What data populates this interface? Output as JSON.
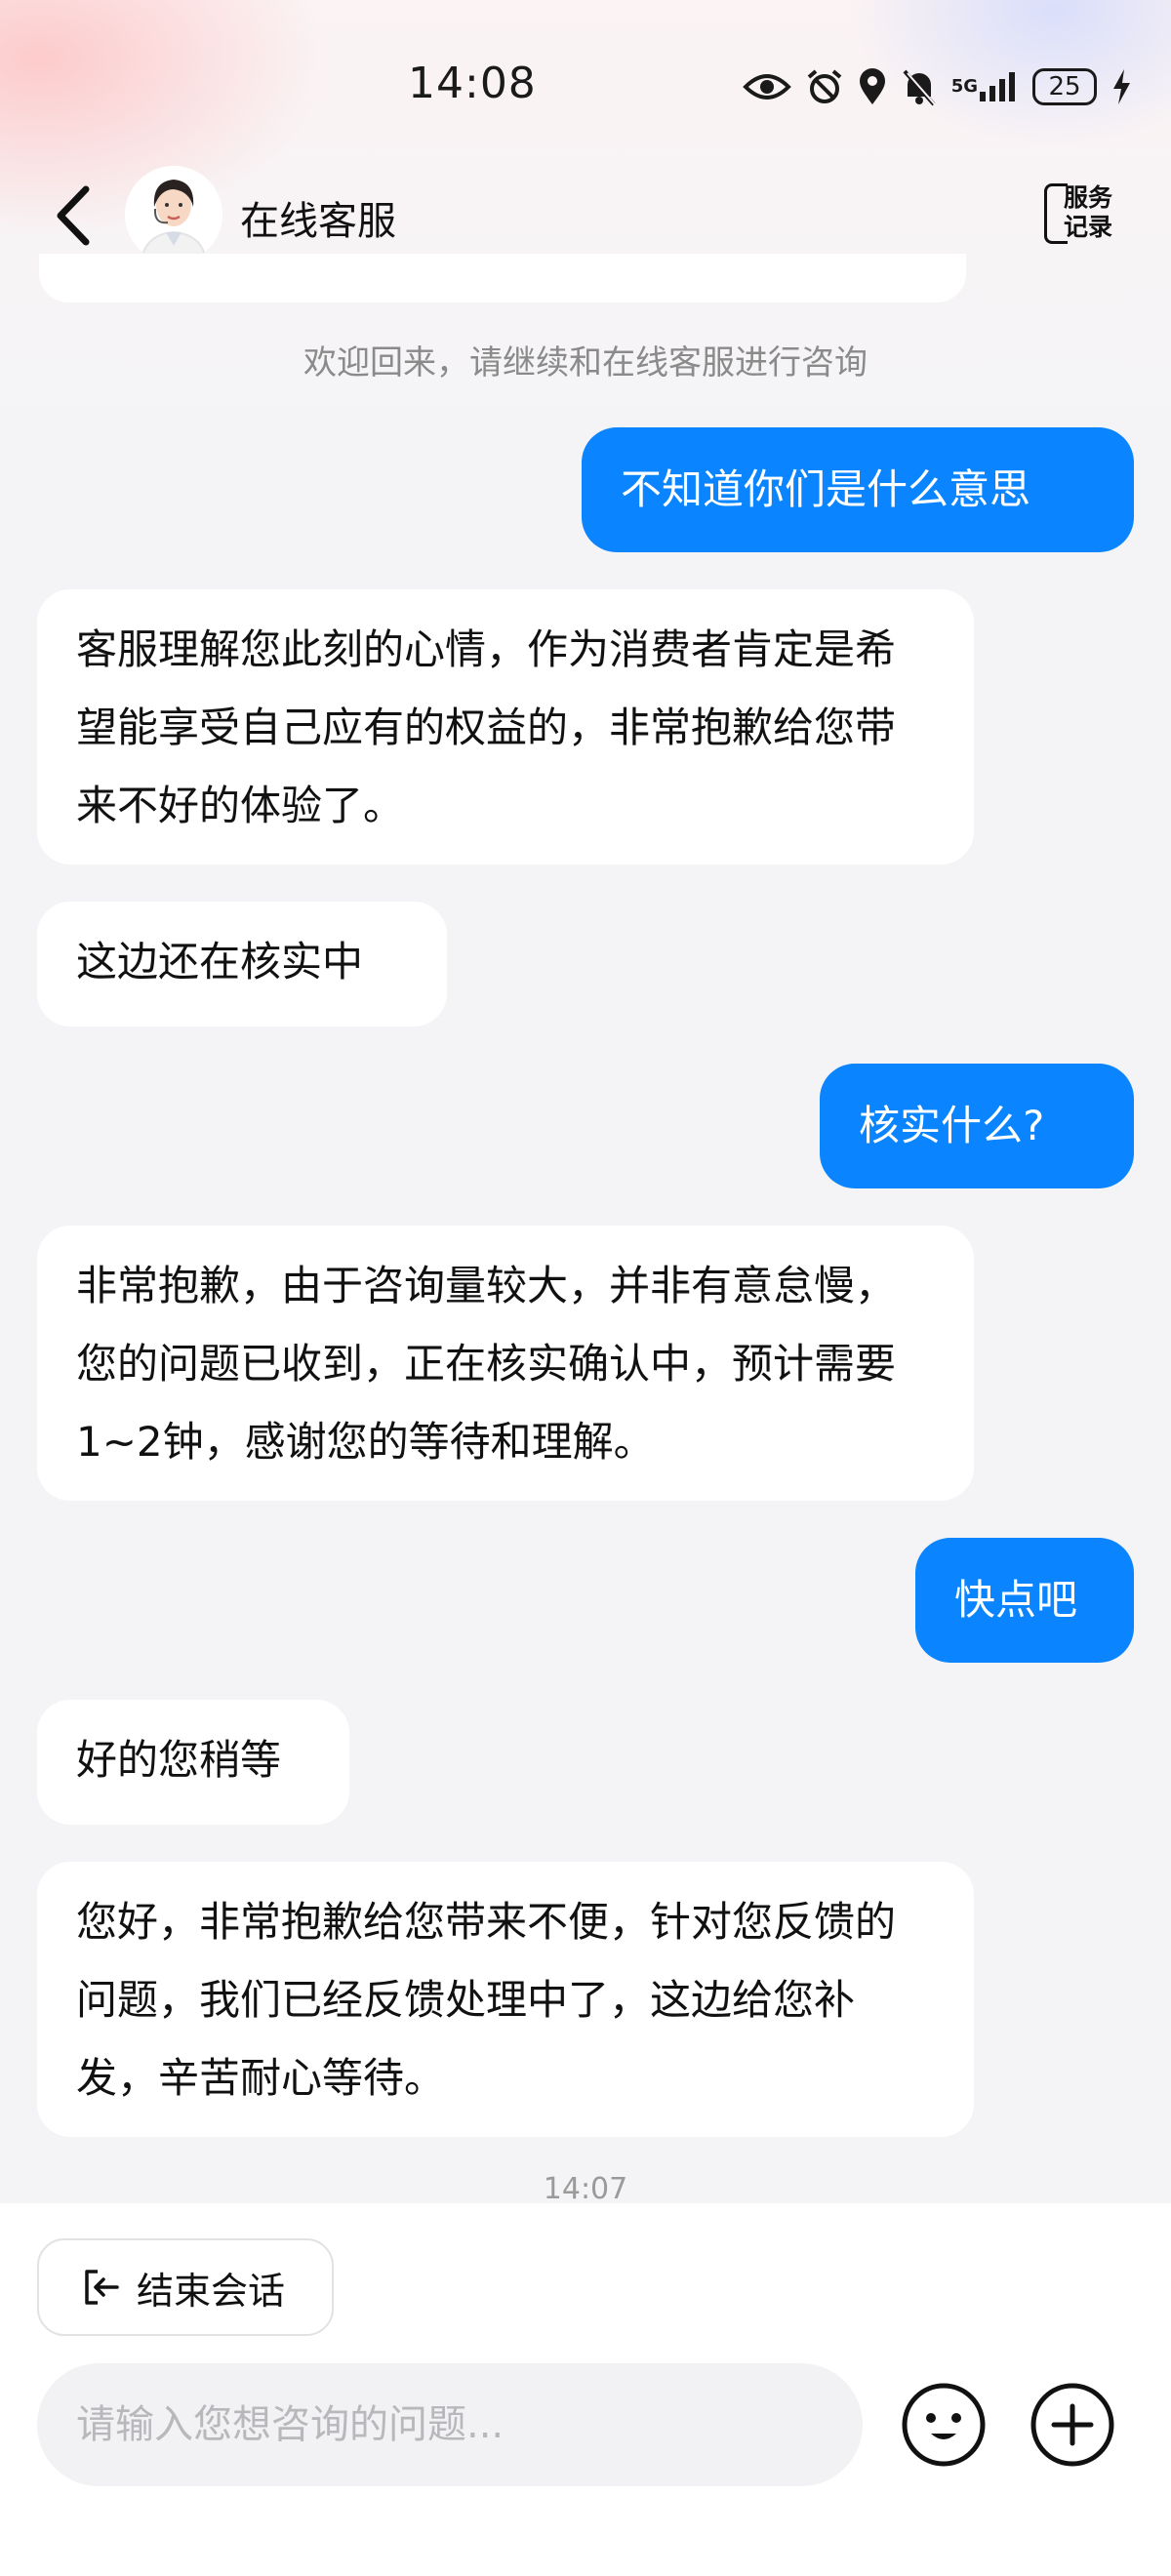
{
  "status_bar": {
    "time": "14:08",
    "network": "5G",
    "battery": "25",
    "icons": [
      "eye-icon",
      "alarm-icon",
      "location-icon",
      "mute-icon",
      "signal-icon",
      "battery-icon",
      "charging-icon"
    ]
  },
  "header": {
    "title": "在线客服",
    "records_line1": "服务",
    "records_line2": "记录"
  },
  "notice": "欢迎回来，请继续和在线客服进行咨询",
  "messages": [
    {
      "from": "user",
      "text": "不知道你们是什么意思"
    },
    {
      "from": "agent",
      "text": "客服理解您此刻的心情，作为消费者肯定是希望能享受自己应有的权益的，非常抱歉给您带来不好的体验了。"
    },
    {
      "from": "agent",
      "text": "这边还在核实中"
    },
    {
      "from": "user",
      "text": "核实什么?"
    },
    {
      "from": "agent",
      "text": "非常抱歉，由于咨询量较大，并非有意怠慢，您的问题已收到，正在核实确认中，预计需要1~2钟，感谢您的等待和理解。"
    },
    {
      "from": "user",
      "text": "快点吧"
    },
    {
      "from": "agent",
      "text": "好的您稍等"
    },
    {
      "from": "agent",
      "text": "您好，非常抱歉给您带来不便，针对您反馈的问题，我们已经反馈处理中了，这边给您补发，辛苦耐心等待。"
    }
  ],
  "timestamp": "14:07",
  "bottom": {
    "end_label": "结束会话",
    "input_placeholder": "请输入您想咨询的问题..."
  },
  "colors": {
    "user_bubble": "#0a84ff",
    "agent_bubble": "#ffffff",
    "background": "#f4f4f6"
  }
}
